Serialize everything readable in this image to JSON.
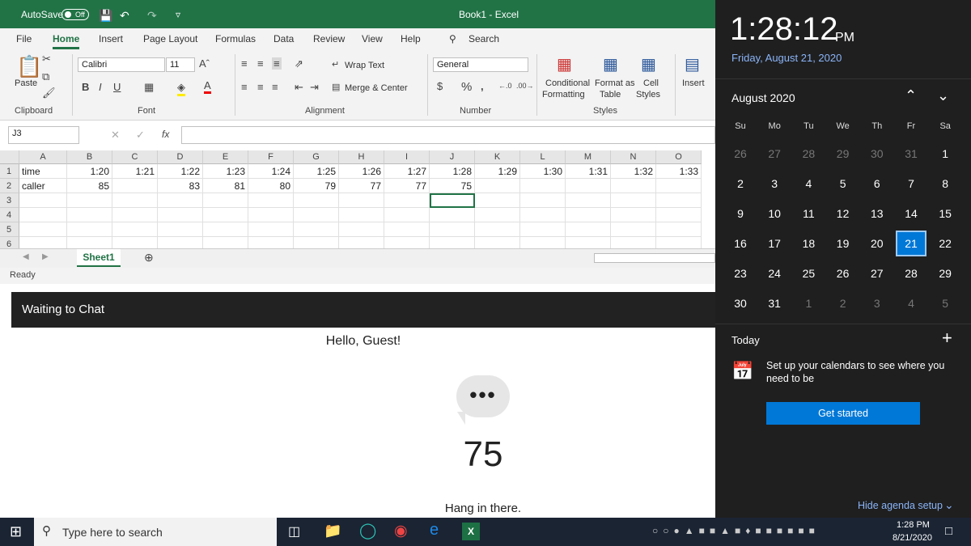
{
  "excel": {
    "autosave": "AutoSave",
    "autosave_state": "Off",
    "title": "Book1 - Excel",
    "tabs": [
      "File",
      "Home",
      "Insert",
      "Page Layout",
      "Formulas",
      "Data",
      "Review",
      "View",
      "Help"
    ],
    "search": "Search",
    "ribbon": {
      "paste": "Paste",
      "clipboard": "Clipboard",
      "font_name": "Calibri",
      "font_size": "11",
      "font": "Font",
      "wrap_text": "Wrap Text",
      "merge_center": "Merge & Center",
      "alignment": "Alignment",
      "number_format": "General",
      "number": "Number",
      "conditional": "Conditional",
      "formatting": "Formatting",
      "format_as": "Format as",
      "table": "Table",
      "cell": "Cell",
      "styles_label": "Styles",
      "styles": "Styles",
      "insert": "Insert",
      "bold": "B",
      "italic": "I",
      "underline": "U",
      "fx": "fx"
    },
    "name_box": "J3",
    "columns": [
      "A",
      "B",
      "C",
      "D",
      "E",
      "F",
      "G",
      "H",
      "I",
      "J",
      "K",
      "L",
      "M",
      "N",
      "O"
    ],
    "rows": [
      [
        "time",
        "1:20",
        "1:21",
        "1:22",
        "1:23",
        "1:24",
        "1:25",
        "1:26",
        "1:27",
        "1:28",
        "1:29",
        "1:30",
        "1:31",
        "1:32",
        "1:33"
      ],
      [
        "caller",
        "85",
        "",
        "83",
        "81",
        "80",
        "79",
        "77",
        "77",
        "75",
        "",
        "",
        "",
        "",
        ""
      ],
      [
        "",
        "",
        "",
        "",
        "",
        "",
        "",
        "",
        "",
        "",
        "",
        "",
        "",
        "",
        ""
      ],
      [
        "",
        "",
        "",
        "",
        "",
        "",
        "",
        "",
        "",
        "",
        "",
        "",
        "",
        "",
        ""
      ],
      [
        "",
        "",
        "",
        "",
        "",
        "",
        "",
        "",
        "",
        "",
        "",
        "",
        "",
        "",
        ""
      ],
      [
        "",
        "",
        "",
        "",
        "",
        "",
        "",
        "",
        "",
        "",
        "",
        "",
        "",
        "",
        ""
      ]
    ],
    "row_numbers": [
      "1",
      "2",
      "3",
      "4",
      "5",
      "6"
    ],
    "sheet": "Sheet1",
    "status": "Ready"
  },
  "chat": {
    "header": "Waiting to Chat",
    "greeting": "Hello, Guest!",
    "queue": "75",
    "message": "Hang in there."
  },
  "calendar": {
    "time": "1:28:12",
    "ampm": "PM",
    "date": "Friday, August 21, 2020",
    "month": "August 2020",
    "weekdays": [
      "Su",
      "Mo",
      "Tu",
      "We",
      "Th",
      "Fr",
      "Sa"
    ],
    "weeks": [
      [
        "26",
        "27",
        "28",
        "29",
        "30",
        "31",
        "1"
      ],
      [
        "2",
        "3",
        "4",
        "5",
        "6",
        "7",
        "8"
      ],
      [
        "9",
        "10",
        "11",
        "12",
        "13",
        "14",
        "15"
      ],
      [
        "16",
        "17",
        "18",
        "19",
        "20",
        "21",
        "22"
      ],
      [
        "23",
        "24",
        "25",
        "26",
        "27",
        "28",
        "29"
      ],
      [
        "30",
        "31",
        "1",
        "2",
        "3",
        "4",
        "5"
      ]
    ],
    "today_label": "Today",
    "setup": "Set up your calendars to see where you need to be",
    "get_started": "Get started",
    "hide": "Hide agenda setup",
    "accent": "#0078d7"
  },
  "taskbar": {
    "search": "Type here to search",
    "time": "1:28 PM",
    "date": "8/21/2020"
  }
}
